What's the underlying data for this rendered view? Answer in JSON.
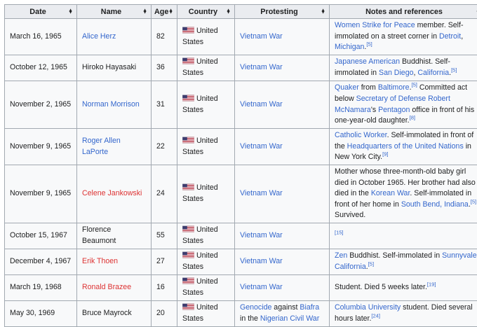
{
  "headers": [
    "Date",
    "Name",
    "Age",
    "Country",
    "Protesting",
    "Notes and references"
  ],
  "country": "United States",
  "rows": [
    {
      "date": "March 16, 1965",
      "name": "Alice Herz",
      "name_link": "blue",
      "age": "82",
      "protesting": "Vietnam War",
      "notes": [
        {
          "t": "Women Strike for Peace",
          "l": 1
        },
        {
          "t": " member. Self-immolated on a street corner in "
        },
        {
          "t": "Detroit",
          "l": 1
        },
        {
          "t": ", "
        },
        {
          "t": "Michigan",
          "l": 1
        },
        {
          "t": ".",
          "ref": "[5]"
        }
      ]
    },
    {
      "date": "October 12, 1965",
      "name": "Hiroko Hayasaki",
      "name_link": "none",
      "age": "36",
      "protesting": "Vietnam War",
      "notes": [
        {
          "t": "Japanese American",
          "l": 1
        },
        {
          "t": " Buddhist. Self-immolated in "
        },
        {
          "t": "San Diego",
          "l": 1
        },
        {
          "t": ", "
        },
        {
          "t": "California",
          "l": 1
        },
        {
          "t": ".",
          "ref": "[5]"
        }
      ]
    },
    {
      "date": "November 2, 1965",
      "name": "Norman Morrison",
      "name_link": "blue",
      "age": "31",
      "protesting": "Vietnam War",
      "notes": [
        {
          "t": "Quaker",
          "l": 1
        },
        {
          "t": " from "
        },
        {
          "t": "Baltimore",
          "l": 1
        },
        {
          "t": ".",
          "ref": "[5]"
        },
        {
          "t": " Committed act below "
        },
        {
          "t": "Secretary of Defense",
          "l": 1
        },
        {
          "t": " "
        },
        {
          "t": "Robert McNamara",
          "l": 1
        },
        {
          "t": "'s "
        },
        {
          "t": "Pentagon",
          "l": 1
        },
        {
          "t": " office in front of his one-year-old daughter.",
          "ref": "[8]"
        }
      ]
    },
    {
      "date": "November 9, 1965",
      "name": "Roger Allen LaPorte",
      "name_link": "blue",
      "age": "22",
      "protesting": "Vietnam War",
      "notes": [
        {
          "t": "Catholic Worker",
          "l": 1
        },
        {
          "t": ". Self-immolated in front of the "
        },
        {
          "t": "Headquarters of the United Nations",
          "l": 1
        },
        {
          "t": " in New York City.",
          "ref": "[9]"
        }
      ]
    },
    {
      "date": "November 9, 1965",
      "name": "Celene Jankowski",
      "name_link": "red",
      "age": "24",
      "protesting": "Vietnam War",
      "notes": [
        {
          "t": "Mother whose three-month-old baby girl died in October 1965. Her brother had also died in the "
        },
        {
          "t": "Korean War",
          "l": 1
        },
        {
          "t": ". Self-immolated in front of her home in "
        },
        {
          "t": "South Bend, Indiana",
          "l": 1
        },
        {
          "t": ".",
          "ref": "[5]"
        },
        {
          "t": " Survived."
        }
      ]
    },
    {
      "date": "October 15, 1967",
      "name": "Florence Beaumont",
      "name_link": "none",
      "age": "55",
      "protesting": "Vietnam War",
      "notes": [
        {
          "t": "",
          "ref": "[15]"
        }
      ]
    },
    {
      "date": "December 4, 1967",
      "name": "Erik Thoen",
      "name_link": "red",
      "age": "27",
      "protesting": "Vietnam War",
      "notes": [
        {
          "t": "Zen",
          "l": 1
        },
        {
          "t": " Buddhist. Self-immolated in "
        },
        {
          "t": "Sunnyvale, California",
          "l": 1
        },
        {
          "t": ".",
          "ref": "[5]"
        }
      ]
    },
    {
      "date": "March 19, 1968",
      "name": "Ronald Brazee",
      "name_link": "red",
      "age": "16",
      "protesting": "Vietnam War",
      "notes": [
        {
          "t": "Student. Died 5 weeks later.",
          "ref": "[19]"
        }
      ]
    },
    {
      "date": "May 30, 1969",
      "name": "Bruce Mayrock",
      "name_link": "none",
      "age": "20",
      "protesting_rich": [
        {
          "t": "Genocide",
          "l": 1
        },
        {
          "t": " against "
        },
        {
          "t": "Biafra",
          "l": 1
        },
        {
          "t": " in the "
        },
        {
          "t": "Nigerian Civil War",
          "l": 1
        }
      ],
      "notes": [
        {
          "t": "Columbia University",
          "l": 1
        },
        {
          "t": " student. Died several hours later.",
          "ref": "[24]"
        }
      ]
    }
  ]
}
